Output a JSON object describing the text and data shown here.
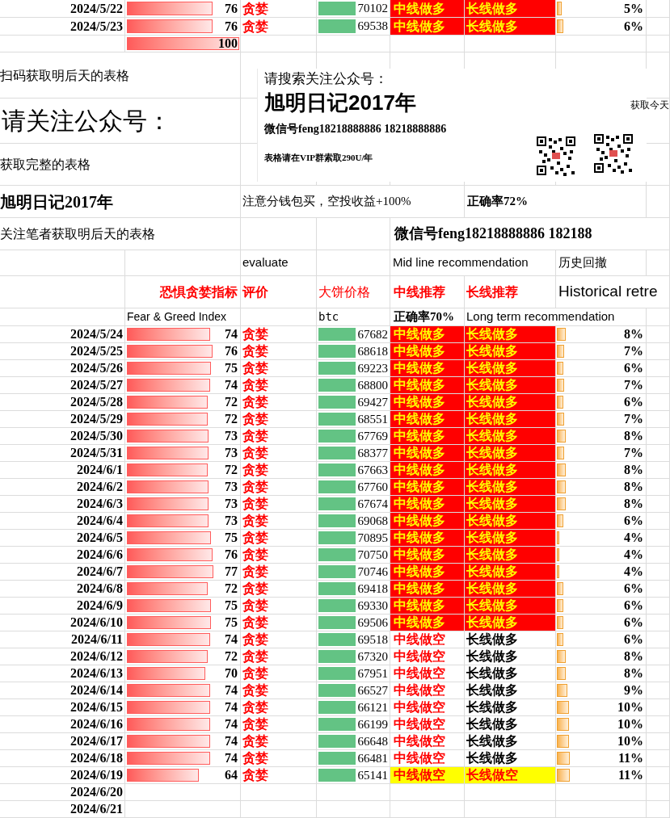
{
  "top_rows": [
    {
      "date": "2024/5/22",
      "index": {
        "value": "76",
        "level": 0.76
      },
      "evaluation": "贪婪",
      "price": "70102",
      "mid": "中线做多",
      "long": "长线做多",
      "kind": "strong",
      "retracement": {
        "value": "5%",
        "level": 0.05
      }
    },
    {
      "date": "2024/5/23",
      "index": {
        "value": "76",
        "level": 0.76
      },
      "evaluation": "贪婪",
      "price": "69538",
      "mid": "中线做多",
      "long": "长线做多",
      "kind": "strong",
      "retracement": {
        "value": "6%",
        "level": 0.07
      }
    }
  ],
  "max_bar": {
    "value": "100",
    "level": 1
  },
  "promo": {
    "scan_note": "扫码获取明后天的表格",
    "follow_heading": "请关注公众号：",
    "full_table_note": "获取完整的表格",
    "account_name": "旭明日记2017年",
    "split_wallet_note": "注意分钱包买，空投收益+100%",
    "accuracy": "正确率72%",
    "follower_note": "关注笔者获取明后天的表格",
    "wechat_line": "微信号feng18218888886   182188",
    "poster": {
      "search_prompt": "请搜索关注公众号：",
      "account_name": "旭明日记2017年",
      "wechat_id": "微信号feng18218888886   18218888886",
      "vip_note": "表格请在VIP群索取290U/年",
      "side_note": "获取今天"
    }
  },
  "header": {
    "evaluate_label": "evaluate",
    "mid_label": "Mid line recommendation",
    "history_label": "历史回撤",
    "fg_title": "恐惧贪婪指标",
    "eval_title": "评价",
    "price_title": "大饼价格",
    "mid_title": "中线推荐",
    "long_title": "长线推荐",
    "historical_title": "Historical retre",
    "fg_subtitle": "Fear & Greed Index",
    "btc_label": "btc",
    "mid_accuracy": "正确率70%",
    "long_label": "Long term recommendation"
  },
  "rows": [
    {
      "date": "2024/5/24",
      "index": {
        "value": "74",
        "level": 0.74
      },
      "evaluation": "贪婪",
      "price": "67682",
      "mid": "中线做多",
      "long": "长线做多",
      "kind": "strong",
      "retracement": {
        "value": "8%",
        "level": 0.1
      }
    },
    {
      "date": "2024/5/25",
      "index": {
        "value": "76",
        "level": 0.76
      },
      "evaluation": "贪婪",
      "price": "68618",
      "mid": "中线做多",
      "long": "长线做多",
      "kind": "strong",
      "retracement": {
        "value": "7%",
        "level": 0.08
      }
    },
    {
      "date": "2024/5/26",
      "index": {
        "value": "75",
        "level": 0.75
      },
      "evaluation": "贪婪",
      "price": "69223",
      "mid": "中线做多",
      "long": "长线做多",
      "kind": "strong",
      "retracement": {
        "value": "6%",
        "level": 0.07
      }
    },
    {
      "date": "2024/5/27",
      "index": {
        "value": "74",
        "level": 0.74
      },
      "evaluation": "贪婪",
      "price": "68800",
      "mid": "中线做多",
      "long": "长线做多",
      "kind": "strong",
      "retracement": {
        "value": "7%",
        "level": 0.08
      }
    },
    {
      "date": "2024/5/28",
      "index": {
        "value": "72",
        "level": 0.72
      },
      "evaluation": "贪婪",
      "price": "69427",
      "mid": "中线做多",
      "long": "长线做多",
      "kind": "strong",
      "retracement": {
        "value": "6%",
        "level": 0.07
      }
    },
    {
      "date": "2024/5/29",
      "index": {
        "value": "72",
        "level": 0.72
      },
      "evaluation": "贪婪",
      "price": "68551",
      "mid": "中线做多",
      "long": "长线做多",
      "kind": "strong",
      "retracement": {
        "value": "7%",
        "level": 0.08
      }
    },
    {
      "date": "2024/5/30",
      "index": {
        "value": "73",
        "level": 0.73
      },
      "evaluation": "贪婪",
      "price": "67769",
      "mid": "中线做多",
      "long": "长线做多",
      "kind": "strong",
      "retracement": {
        "value": "8%",
        "level": 0.1
      }
    },
    {
      "date": "2024/5/31",
      "index": {
        "value": "73",
        "level": 0.73
      },
      "evaluation": "贪婪",
      "price": "68377",
      "mid": "中线做多",
      "long": "长线做多",
      "kind": "strong",
      "retracement": {
        "value": "7%",
        "level": 0.08
      }
    },
    {
      "date": "2024/6/1",
      "index": {
        "value": "72",
        "level": 0.72
      },
      "evaluation": "贪婪",
      "price": "67663",
      "mid": "中线做多",
      "long": "长线做多",
      "kind": "strong",
      "retracement": {
        "value": "8%",
        "level": 0.1
      }
    },
    {
      "date": "2024/6/2",
      "index": {
        "value": "73",
        "level": 0.73
      },
      "evaluation": "贪婪",
      "price": "67760",
      "mid": "中线做多",
      "long": "长线做多",
      "kind": "strong",
      "retracement": {
        "value": "8%",
        "level": 0.1
      }
    },
    {
      "date": "2024/6/3",
      "index": {
        "value": "73",
        "level": 0.73
      },
      "evaluation": "贪婪",
      "price": "67674",
      "mid": "中线做多",
      "long": "长线做多",
      "kind": "strong",
      "retracement": {
        "value": "8%",
        "level": 0.1
      }
    },
    {
      "date": "2024/6/4",
      "index": {
        "value": "73",
        "level": 0.73
      },
      "evaluation": "贪婪",
      "price": "69068",
      "mid": "中线做多",
      "long": "长线做多",
      "kind": "strong",
      "retracement": {
        "value": "6%",
        "level": 0.07
      }
    },
    {
      "date": "2024/6/5",
      "index": {
        "value": "75",
        "level": 0.75
      },
      "evaluation": "贪婪",
      "price": "70895",
      "mid": "中线做多",
      "long": "长线做多",
      "kind": "strong",
      "retracement": {
        "value": "4%",
        "level": 0.03
      }
    },
    {
      "date": "2024/6/6",
      "index": {
        "value": "76",
        "level": 0.76
      },
      "evaluation": "贪婪",
      "price": "70750",
      "mid": "中线做多",
      "long": "长线做多",
      "kind": "strong",
      "retracement": {
        "value": "4%",
        "level": 0.03
      }
    },
    {
      "date": "2024/6/7",
      "index": {
        "value": "77",
        "level": 0.77
      },
      "evaluation": "贪婪",
      "price": "70746",
      "mid": "中线做多",
      "long": "长线做多",
      "kind": "strong",
      "retracement": {
        "value": "4%",
        "level": 0.03
      }
    },
    {
      "date": "2024/6/8",
      "index": {
        "value": "72",
        "level": 0.72
      },
      "evaluation": "贪婪",
      "price": "69418",
      "mid": "中线做多",
      "long": "长线做多",
      "kind": "strong",
      "retracement": {
        "value": "6%",
        "level": 0.07
      }
    },
    {
      "date": "2024/6/9",
      "index": {
        "value": "75",
        "level": 0.75
      },
      "evaluation": "贪婪",
      "price": "69330",
      "mid": "中线做多",
      "long": "长线做多",
      "kind": "strong",
      "retracement": {
        "value": "6%",
        "level": 0.07
      }
    },
    {
      "date": "2024/6/10",
      "index": {
        "value": "75",
        "level": 0.75
      },
      "evaluation": "贪婪",
      "price": "69506",
      "mid": "中线做多",
      "long": "长线做多",
      "kind": "strong",
      "retracement": {
        "value": "6%",
        "level": 0.07
      }
    },
    {
      "date": "2024/6/11",
      "index": {
        "value": "74",
        "level": 0.74
      },
      "evaluation": "贪婪",
      "price": "69518",
      "mid": "中线做空",
      "long": "长线做多",
      "kind": "plain",
      "retracement": {
        "value": "6%",
        "level": 0.07
      }
    },
    {
      "date": "2024/6/12",
      "index": {
        "value": "72",
        "level": 0.72
      },
      "evaluation": "贪婪",
      "price": "67320",
      "mid": "中线做空",
      "long": "长线做多",
      "kind": "plain",
      "retracement": {
        "value": "8%",
        "level": 0.1
      }
    },
    {
      "date": "2024/6/13",
      "index": {
        "value": "70",
        "level": 0.7
      },
      "evaluation": "贪婪",
      "price": "67951",
      "mid": "中线做空",
      "long": "长线做多",
      "kind": "plain",
      "retracement": {
        "value": "8%",
        "level": 0.1
      }
    },
    {
      "date": "2024/6/14",
      "index": {
        "value": "74",
        "level": 0.74
      },
      "evaluation": "贪婪",
      "price": "66527",
      "mid": "中线做空",
      "long": "长线做多",
      "kind": "plain",
      "retracement": {
        "value": "9%",
        "level": 0.12
      }
    },
    {
      "date": "2024/6/15",
      "index": {
        "value": "74",
        "level": 0.74
      },
      "evaluation": "贪婪",
      "price": "66121",
      "mid": "中线做空",
      "long": "长线做多",
      "kind": "plain",
      "retracement": {
        "value": "10%",
        "level": 0.13
      }
    },
    {
      "date": "2024/6/16",
      "index": {
        "value": "74",
        "level": 0.74
      },
      "evaluation": "贪婪",
      "price": "66199",
      "mid": "中线做空",
      "long": "长线做多",
      "kind": "plain",
      "retracement": {
        "value": "10%",
        "level": 0.13
      }
    },
    {
      "date": "2024/6/17",
      "index": {
        "value": "74",
        "level": 0.74
      },
      "evaluation": "贪婪",
      "price": "66648",
      "mid": "中线做空",
      "long": "长线做多",
      "kind": "plain",
      "retracement": {
        "value": "10%",
        "level": 0.13
      }
    },
    {
      "date": "2024/6/18",
      "index": {
        "value": "74",
        "level": 0.74
      },
      "evaluation": "贪婪",
      "price": "66481",
      "mid": "中线做空",
      "long": "长线做多",
      "kind": "plain",
      "retracement": {
        "value": "11%",
        "level": 0.14
      }
    },
    {
      "date": "2024/6/19",
      "index": {
        "value": "64",
        "level": 0.64
      },
      "evaluation": "贪婪",
      "price": "65141",
      "mid": "中线做空",
      "long": "长线做空",
      "kind": "warning",
      "retracement": {
        "value": "11%",
        "level": 0.14
      }
    },
    {
      "date": "2024/6/20"
    },
    {
      "date": "2024/6/21"
    }
  ]
}
